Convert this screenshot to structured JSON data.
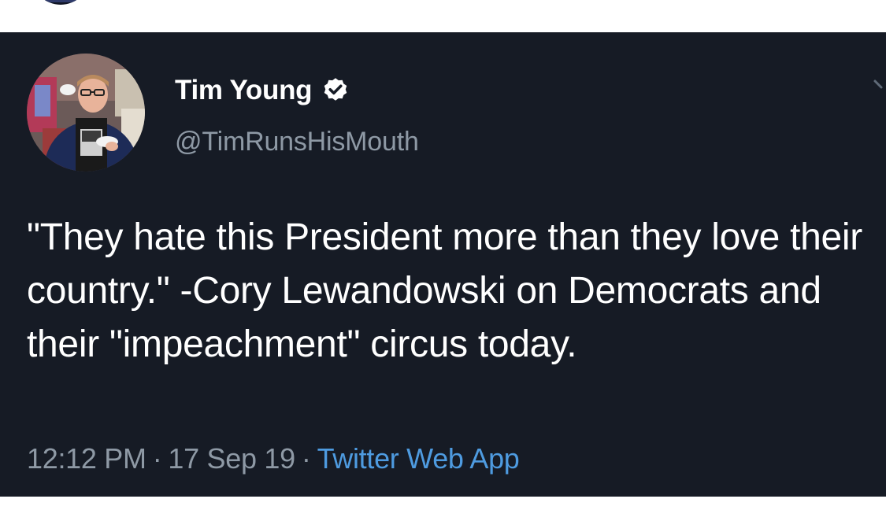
{
  "tweet": {
    "author_name": "Tim Young",
    "author_handle": "@TimRunsHisMouth",
    "verified": true,
    "text": "\"They hate this President more than they love their country.\" -Cory Lewandowski on Democrats and their \"impeachment\" circus today.",
    "time": "12:12 PM",
    "date": "17 Sep 19",
    "source": "Twitter Web App",
    "separator": "·"
  },
  "icons": {
    "verified": "verified-badge-icon",
    "menu": "chevron-down-icon"
  },
  "colors": {
    "card_background": "#161b25",
    "text_primary": "#ffffff",
    "text_secondary": "#8e99a5",
    "link": "#4e9be0"
  }
}
